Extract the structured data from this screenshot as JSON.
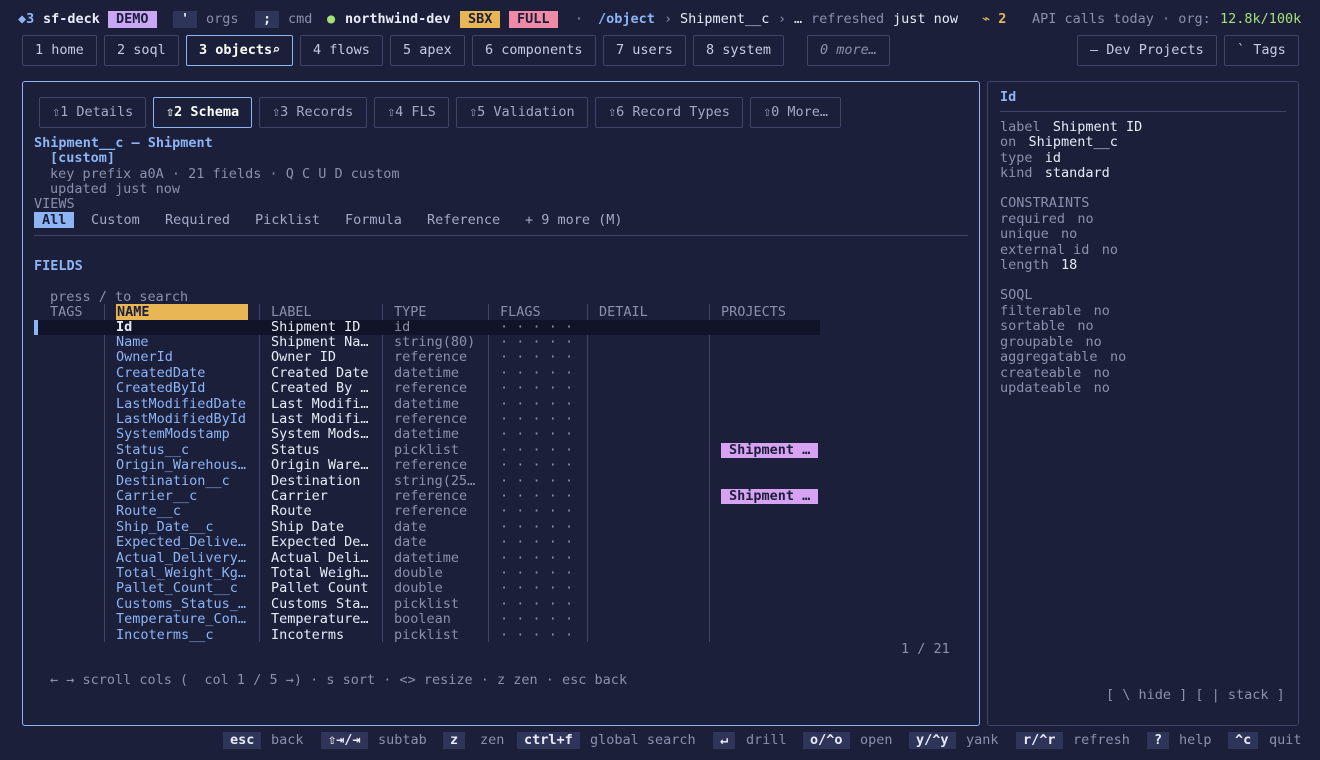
{
  "topbar": {
    "diamond": "◆3",
    "app": "sf-deck",
    "demo": "DEMO",
    "orgs_key": "'",
    "orgs_label": "orgs",
    "cmd_key": ";",
    "cmd_label": "cmd",
    "status_dot": "●",
    "org_name": "northwind-dev",
    "sbx": "SBX",
    "full": "FULL",
    "sep": "·",
    "path_root": "/object",
    "path_sep1": "›",
    "path_obj": "Shipment__c",
    "path_sep2": "›",
    "path_more": "…",
    "refreshed_label": "refreshed",
    "refreshed_value": "just now",
    "alert": "⌁ 2",
    "api_label": "API calls today · org:",
    "api_value": "12.8k/100k",
    "colors": {
      "demo": "#c9a7f5",
      "sbx": "#e8b655",
      "full": "#f08aa6",
      "dot": "#a5e07a",
      "alert": "#e8b655",
      "api": "#a5e07a"
    }
  },
  "nav": {
    "tabs": [
      {
        "label": "1 home"
      },
      {
        "label": "2 soql"
      },
      {
        "label": "3 objects⌕"
      },
      {
        "label": "4 flows"
      },
      {
        "label": "5 apex"
      },
      {
        "label": "6 components"
      },
      {
        "label": "7 users"
      },
      {
        "label": "8 system"
      }
    ],
    "more": "0 more…",
    "dev_projects": "— Dev Projects",
    "tags": "` Tags"
  },
  "main": {
    "subtabs": [
      {
        "label": "⇧1 Details"
      },
      {
        "label": "⇧2 Schema"
      },
      {
        "label": "⇧3 Records"
      },
      {
        "label": "⇧4 FLS"
      },
      {
        "label": "⇧5 Validation"
      },
      {
        "label": "⇧6 Record Types"
      },
      {
        "label": "⇧0 More…"
      }
    ],
    "object_title": "Shipment__c — Shipment",
    "object_tag": "[custom]",
    "meta_line": "key prefix a0A · 21 fields · Q C U D custom",
    "updated_line": "updated just now",
    "views_heading": "VIEWS",
    "views": [
      "All",
      "Custom",
      "Required",
      "Picklist",
      "Formula",
      "Reference",
      "+ 9 more (M)"
    ],
    "fields_heading": "FIELDS",
    "search_hint": "press / to search",
    "columns": [
      "TAGS",
      "NAME",
      "LABEL",
      "TYPE",
      "FLAGS",
      "DETAIL",
      "PROJECTS"
    ],
    "rows": [
      {
        "name": "Id",
        "label": "Shipment ID",
        "type": "id",
        "flags": "· · · · ·",
        "project": ""
      },
      {
        "name": "Name",
        "label": "Shipment Na…",
        "type": "string(80)",
        "flags": "· · · · ·",
        "project": ""
      },
      {
        "name": "OwnerId",
        "label": "Owner ID",
        "type": "reference",
        "flags": "· · · · ·",
        "project": ""
      },
      {
        "name": "CreatedDate",
        "label": "Created Date",
        "type": "datetime",
        "flags": "· · · · ·",
        "project": ""
      },
      {
        "name": "CreatedById",
        "label": "Created By …",
        "type": "reference",
        "flags": "· · · · ·",
        "project": ""
      },
      {
        "name": "LastModifiedDate",
        "label": "Last Modifi…",
        "type": "datetime",
        "flags": "· · · · ·",
        "project": ""
      },
      {
        "name": "LastModifiedById",
        "label": "Last Modifi…",
        "type": "reference",
        "flags": "· · · · ·",
        "project": ""
      },
      {
        "name": "SystemModstamp",
        "label": "System Mods…",
        "type": "datetime",
        "flags": "· · · · ·",
        "project": ""
      },
      {
        "name": "Status__c",
        "label": "Status",
        "type": "picklist",
        "flags": "· · · · ·",
        "project": "Shipment …"
      },
      {
        "name": "Origin_Warehous…",
        "label": "Origin Ware…",
        "type": "reference",
        "flags": "· · · · ·",
        "project": ""
      },
      {
        "name": "Destination__c",
        "label": "Destination",
        "type": "string(25…",
        "flags": "· · · · ·",
        "project": ""
      },
      {
        "name": "Carrier__c",
        "label": "Carrier",
        "type": "reference",
        "flags": "· · · · ·",
        "project": "Shipment …"
      },
      {
        "name": "Route__c",
        "label": "Route",
        "type": "reference",
        "flags": "· · · · ·",
        "project": ""
      },
      {
        "name": "Ship_Date__c",
        "label": "Ship Date",
        "type": "date",
        "flags": "· · · · ·",
        "project": ""
      },
      {
        "name": "Expected_Delive…",
        "label": "Expected De…",
        "type": "date",
        "flags": "· · · · ·",
        "project": ""
      },
      {
        "name": "Actual_Delivery…",
        "label": "Actual Deli…",
        "type": "datetime",
        "flags": "· · · · ·",
        "project": ""
      },
      {
        "name": "Total_Weight_Kg…",
        "label": "Total Weigh…",
        "type": "double",
        "flags": "· · · · ·",
        "project": ""
      },
      {
        "name": "Pallet_Count__c",
        "label": "Pallet Count",
        "type": "double",
        "flags": "· · · · ·",
        "project": ""
      },
      {
        "name": "Customs_Status_…",
        "label": "Customs Sta…",
        "type": "picklist",
        "flags": "· · · · ·",
        "project": ""
      },
      {
        "name": "Temperature_Con…",
        "label": "Temperature…",
        "type": "boolean",
        "flags": "· · · · ·",
        "project": ""
      },
      {
        "name": "Incoterms__c",
        "label": "Incoterms",
        "type": "picklist",
        "flags": "· · · · ·",
        "project": ""
      }
    ],
    "position": "1 / 21",
    "hint": "← → scroll cols (  col 1 / 5 →) · s sort · <> resize · z zen · esc back"
  },
  "side": {
    "title": "Id",
    "info": [
      {
        "k": "label",
        "v": "Shipment ID"
      },
      {
        "k": "on",
        "v": "Shipment__c"
      },
      {
        "k": "type",
        "v": "id"
      },
      {
        "k": "kind",
        "v": "standard"
      }
    ],
    "constraints_heading": "CONSTRAINTS",
    "constraints": [
      {
        "k": "required",
        "v": "no"
      },
      {
        "k": "unique",
        "v": "no"
      },
      {
        "k": "external id",
        "v": "no"
      },
      {
        "k": "length",
        "v": "18"
      }
    ],
    "soql_heading": "SOQL",
    "soql": [
      {
        "k": "filterable",
        "v": "no"
      },
      {
        "k": "sortable",
        "v": "no"
      },
      {
        "k": "groupable",
        "v": "no"
      },
      {
        "k": "aggregatable",
        "v": "no"
      },
      {
        "k": "createable",
        "v": "no"
      },
      {
        "k": "updateable",
        "v": "no"
      }
    ],
    "footer": "[ \\ hide ] [ | stack ]"
  },
  "bottombar": {
    "keys": [
      {
        "key": "esc",
        "label": "back"
      },
      {
        "key": "⇧⇥/⇥",
        "label": "subtab"
      },
      {
        "key": "z",
        "label": "zen"
      },
      {
        "key": "ctrl+f",
        "label": "global search"
      },
      {
        "key": "↵",
        "label": "drill"
      },
      {
        "key": "o/^o",
        "label": "open"
      },
      {
        "key": "y/^y",
        "label": "yank"
      },
      {
        "key": "r/^r",
        "label": "refresh"
      },
      {
        "key": "?",
        "label": "help"
      },
      {
        "key": "^c",
        "label": "quit"
      }
    ]
  }
}
